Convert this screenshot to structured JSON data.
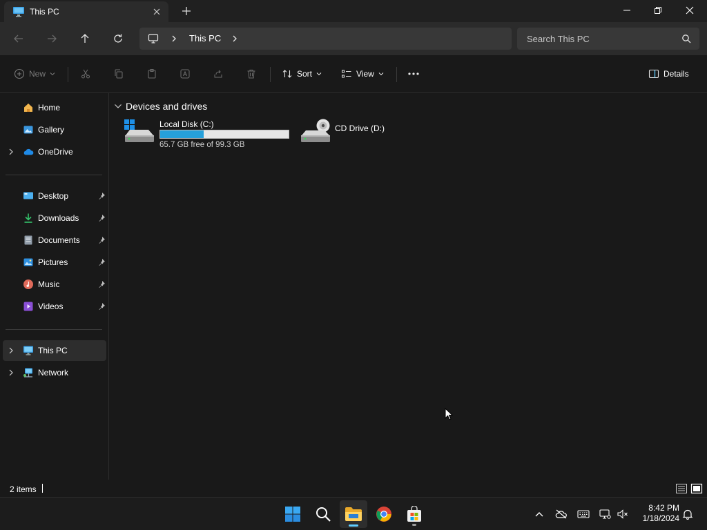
{
  "window": {
    "tab_title": "This PC",
    "new_tab_label": "+"
  },
  "address": {
    "crumbs": [
      "This PC"
    ]
  },
  "search": {
    "placeholder": "Search This PC"
  },
  "commandbar": {
    "new_label": "New",
    "sort_label": "Sort",
    "view_label": "View",
    "details_label": "Details"
  },
  "sidebar": {
    "items": [
      {
        "label": "Home",
        "icon": "home-icon"
      },
      {
        "label": "Gallery",
        "icon": "gallery-icon"
      },
      {
        "label": "OneDrive",
        "icon": "onedrive-icon"
      },
      {
        "label": "Desktop",
        "icon": "desktop-icon"
      },
      {
        "label": "Downloads",
        "icon": "downloads-icon"
      },
      {
        "label": "Documents",
        "icon": "documents-icon"
      },
      {
        "label": "Pictures",
        "icon": "pictures-icon"
      },
      {
        "label": "Music",
        "icon": "music-icon"
      },
      {
        "label": "Videos",
        "icon": "videos-icon"
      },
      {
        "label": "This PC",
        "icon": "this-pc-icon"
      },
      {
        "label": "Network",
        "icon": "network-icon"
      }
    ]
  },
  "content": {
    "group_label": "Devices and drives",
    "drives": [
      {
        "name": "Local Disk (C:)",
        "free_text": "65.7 GB free of 99.3 GB",
        "used_fraction": 0.338
      },
      {
        "name": "CD Drive (D:)"
      }
    ]
  },
  "status": {
    "item_count": "2 items"
  },
  "taskbar": {
    "time": "8:42 PM",
    "date": "1/18/2024"
  },
  "colors": {
    "accent": "#60cdff",
    "progress_fill": "#26a0da",
    "background": "#191919"
  }
}
